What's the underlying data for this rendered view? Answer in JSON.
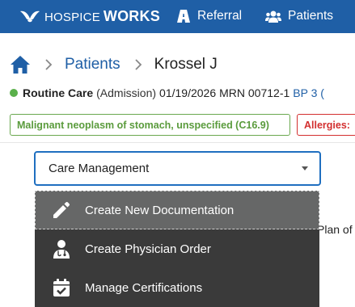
{
  "app": {
    "brand_light": "HOSPICE",
    "brand_bold": "WORKS"
  },
  "nav": {
    "referral": "Referral",
    "patients": "Patients"
  },
  "breadcrumb": {
    "link": "Patients",
    "current": "Krossel J"
  },
  "status": {
    "care": "Routine Care",
    "admission": "(Admission)",
    "date": "01/19/2026",
    "mrn": "MRN 00712-1",
    "bp": "BP 3 (",
    "dot_color": "#5ab04b"
  },
  "badges": {
    "diagnosis": "Malignant neoplasm of stomach, unspecified (C16.9)",
    "allergies": "Allergies:"
  },
  "select": {
    "value": "Care Management"
  },
  "background": {
    "plan_text": "Plan of"
  },
  "menu": {
    "items": [
      {
        "label": "Create New Documentation",
        "icon": "pencil-icon"
      },
      {
        "label": "Create Physician Order",
        "icon": "physician-icon"
      },
      {
        "label": "Manage Certifications",
        "icon": "calendar-check-icon"
      }
    ]
  },
  "colors": {
    "primary": "#1f5fa6",
    "success": "#5ab04b",
    "danger": "#d32f2f",
    "menu_bg": "#3a3a3a",
    "menu_active": "#666767"
  }
}
